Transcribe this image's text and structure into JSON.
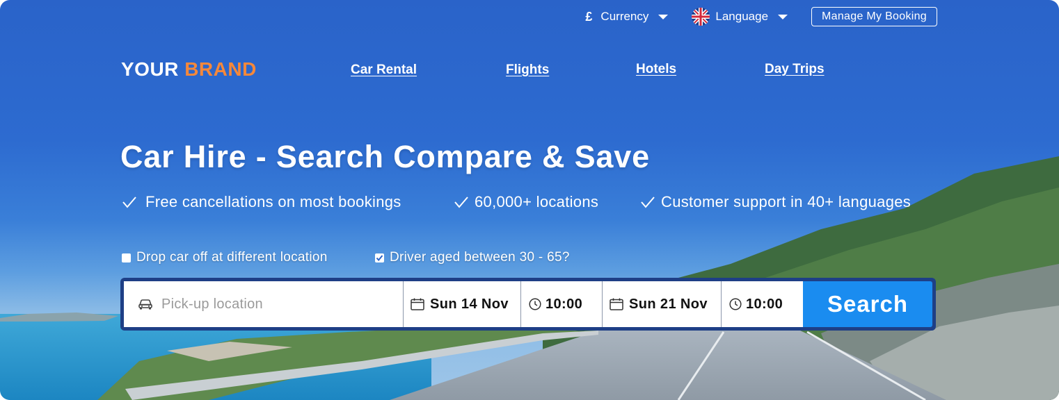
{
  "topbar": {
    "currency_symbol": "£",
    "currency_label": "Currency",
    "language_label": "Language",
    "manage_booking_label": "Manage My Booking"
  },
  "brand": {
    "part1": "YOUR",
    "part2": "BRAND",
    "accent_color": "#f5883b"
  },
  "nav": [
    {
      "label": "Car Rental"
    },
    {
      "label": "Flights"
    },
    {
      "label": "Hotels"
    },
    {
      "label": "Day Trips"
    }
  ],
  "hero": {
    "headline": "Car Hire - Search Compare & Save",
    "benefits": [
      "Free cancellations on most bookings",
      "60,000+ locations",
      "Customer support in 40+ languages"
    ]
  },
  "options": {
    "drop_off_label": "Drop car off at different location",
    "drop_off_checked": false,
    "driver_age_label": "Driver aged between 30 - 65?",
    "driver_age_checked": true
  },
  "search": {
    "pickup_placeholder": "Pick-up location",
    "pickup_value": "",
    "pickup_date": "Sun 14 Nov",
    "pickup_time": "10:00",
    "dropoff_date": "Sun 21 Nov",
    "dropoff_time": "10:00",
    "button_label": "Search",
    "button_color": "#1a8cf0"
  },
  "icons": {
    "currency": "pound-sign",
    "language": "uk-flag-icon",
    "car": "car-icon",
    "date": "calendar-icon",
    "time": "clock-icon",
    "benefit": "check-icon"
  }
}
